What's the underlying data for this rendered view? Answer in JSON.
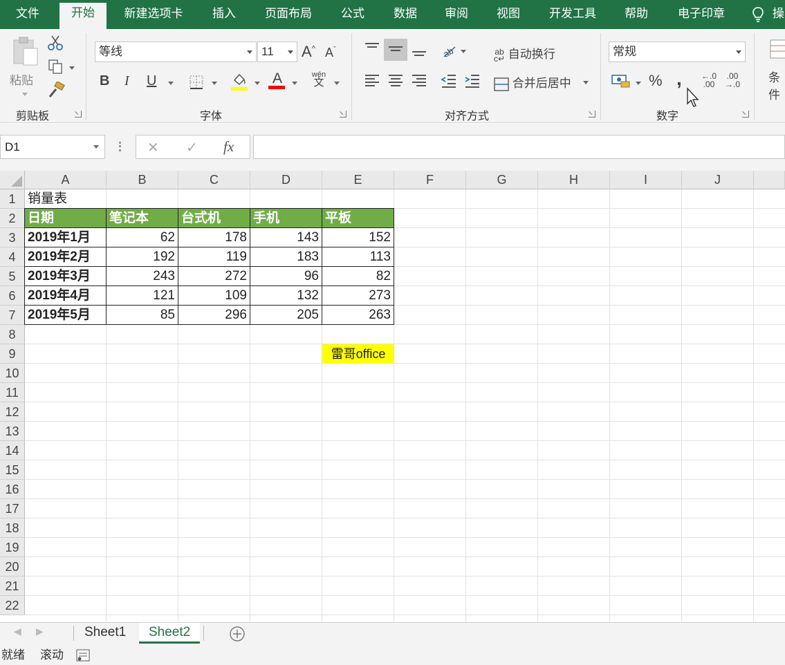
{
  "ribbon_tabs": [
    "文件",
    "开始",
    "新建选项卡",
    "插入",
    "页面布局",
    "公式",
    "数据",
    "审阅",
    "视图",
    "开发工具",
    "帮助",
    "电子印章",
    "操"
  ],
  "ribbon": {
    "clipboard": {
      "paste_label": "粘贴",
      "group_label": "剪贴板"
    },
    "font": {
      "font_name": "等线",
      "font_size": "11",
      "bold": "B",
      "italic": "I",
      "underline": "U",
      "grow": "A",
      "shrink": "A",
      "phonetic_top": "wén",
      "phonetic_bottom": "文",
      "font_color_glyph": "A",
      "group_label": "字体",
      "fill_color": "#ffff00",
      "font_color": "#ff0000"
    },
    "alignment": {
      "wrap_text": "自动换行",
      "merge_center": "合并后居中",
      "group_label": "对齐方式"
    },
    "number": {
      "format": "常规",
      "percent": "%",
      "comma": ",",
      "inc_decimal_top": "←.0",
      "inc_decimal_bottom": ".00",
      "dec_decimal_top": ".00",
      "dec_decimal_bottom": "→.0",
      "group_label": "数字"
    },
    "styles": {
      "conditional_cut": "条件"
    }
  },
  "formula_bar": {
    "name_box": "D1",
    "cancel": "✕",
    "enter": "✓",
    "fx": "fx",
    "formula": ""
  },
  "columns": [
    "A",
    "B",
    "C",
    "D",
    "E",
    "F",
    "G",
    "H",
    "I",
    "J"
  ],
  "rows": [
    "1",
    "2",
    "3",
    "4",
    "5",
    "6",
    "7",
    "8",
    "9",
    "10",
    "11",
    "12",
    "13",
    "14",
    "15",
    "16",
    "17",
    "18",
    "19",
    "20",
    "21",
    "22"
  ],
  "sheet": {
    "title": "销量表",
    "header": [
      "日期",
      "笔记本",
      "台式机",
      "手机",
      "平板"
    ],
    "data": [
      [
        "2019年1月",
        "62",
        "178",
        "143",
        "152"
      ],
      [
        "2019年2月",
        "192",
        "119",
        "183",
        "113"
      ],
      [
        "2019年3月",
        "243",
        "272",
        "96",
        "82"
      ],
      [
        "2019年4月",
        "121",
        "109",
        "132",
        "273"
      ],
      [
        "2019年5月",
        "85",
        "296",
        "205",
        "263"
      ]
    ],
    "note": "雷哥office",
    "header_color": "#70ad47",
    "note_color": "#ffff00"
  },
  "sheet_tabs": [
    "Sheet1",
    "Sheet2"
  ],
  "active_sheet": "Sheet2",
  "status": {
    "ready": "就绪",
    "scroll": "滚动"
  }
}
